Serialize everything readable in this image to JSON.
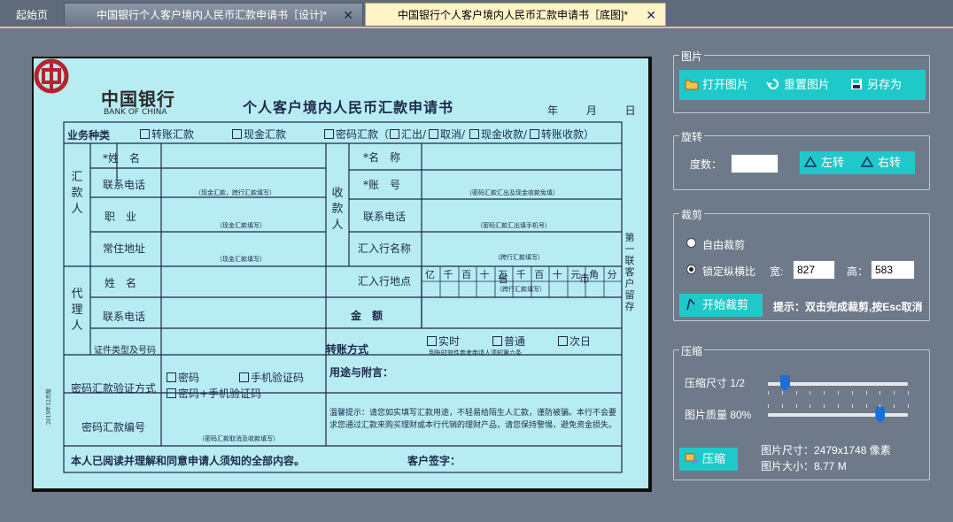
{
  "tabs": {
    "home": "起始页",
    "tab1": "中国银行个人客户境内人民币汇款申请书［设计]*",
    "tab2": "中国银行个人客户境内人民币汇款申请书［底图]*",
    "close": "✕"
  },
  "document": {
    "bank_name": "中国银行",
    "bank_en": "BANK OF CHINA",
    "title": "个人客户境内人民币汇款申请书",
    "date": "年 月 日",
    "biz_type": "业务种类",
    "opt_transfer": "转账汇款",
    "opt_cash": "现金汇款",
    "opt_pwd": "密码汇款（",
    "opt_pwd_rest": "汇出/",
    "opt_cancel": "取消/",
    "opt_cash_recv": "现金收款/",
    "opt_transfer_recv": "转账收款）",
    "remitter": "汇款人",
    "name": "*姓　名",
    "phone": "联系电话",
    "phone_note": "（现金汇款，跨行汇款填写）",
    "job": "职　业",
    "job_note": "（现金汇款填写）",
    "addr": "常住地址",
    "addr_note": "（现金汇款填写）",
    "agent": "代理人",
    "agent_name": "姓　名",
    "agent_phone": "联系电话",
    "id_type": "证件类型及号码",
    "payee": "收款人",
    "payee_name": "*名　称",
    "payee_acct": "*账　号",
    "acct_note": "（密码汇款汇出及现金收款免填）",
    "payee_phone": "联系电话",
    "payee_phone_note": "（密码汇款汇出填手机号）",
    "bank_name_label": "汇入行名称",
    "bank_name_note": "（跨行汇款填写）",
    "bank_place": "汇入行地点",
    "province": "省",
    "city": "市",
    "bank_place_note": "（跨行汇款填写）",
    "amount": "金　额",
    "units": [
      "亿",
      "千",
      "百",
      "十",
      "万",
      "千",
      "百",
      "十",
      "元",
      "角",
      "分"
    ],
    "pwd_verify": "密码汇款验证方式",
    "verify_pwd": "密码",
    "verify_sms": "手机验证码",
    "verify_both": "密码+手机验证码",
    "pwd_no": "密码汇款编号",
    "pwd_no_note": "（密码汇款取消及收款填写）",
    "transfer_mode": "转账方式",
    "mode_rt": "实时",
    "mode_normal": "普通",
    "mode_next": "次日",
    "mode_note": "到账时效性参考申请人须知第六条",
    "purpose": "用途与附言：",
    "tip": "温馨提示：请您如实填写汇款用途，不轻易给陌生人汇款，谨防被骗。本行不会要求您通过汇款来购买理财或本行代销的理财产品，请您保持警惕，避免资金损失。",
    "ack": "本人已阅读并理解和同意申请人须知的全部内容。",
    "sign": "客户签字：",
    "copy_side": "第一联　客户留存",
    "left_side": "2019年12月版"
  },
  "image_panel": {
    "title": "图片",
    "open": "打开图片",
    "reset": "重置图片",
    "save_as": "另存为"
  },
  "rotate_panel": {
    "title": "旋转",
    "degree_label": "度数：",
    "degree_value": "",
    "left": "左转",
    "right": "右转"
  },
  "crop_panel": {
    "title": "裁剪",
    "free": "自由裁剪",
    "lock": "锁定纵横比",
    "selected": "lock",
    "width_label": "宽:",
    "width_value": "827",
    "height_label": "高：",
    "height_value": "583",
    "start": "开始裁剪",
    "hint": "提示：双击完成裁剪,按Esc取消"
  },
  "compress_panel": {
    "title": "压缩",
    "size_label": "压缩尺寸 1/2",
    "size_level": 0.12,
    "quality_label": "图片质量 80%",
    "quality_level": 0.8,
    "dim": "图片尺寸：2479x1748 像素",
    "filesize": "图片大小：8.77 M",
    "compress": "压缩"
  },
  "colors": {
    "accent_button": "#1fc9c9",
    "active_tab": "#fff3c8",
    "background": "#6e7a8a",
    "document_bg": "#b6ecf2"
  }
}
